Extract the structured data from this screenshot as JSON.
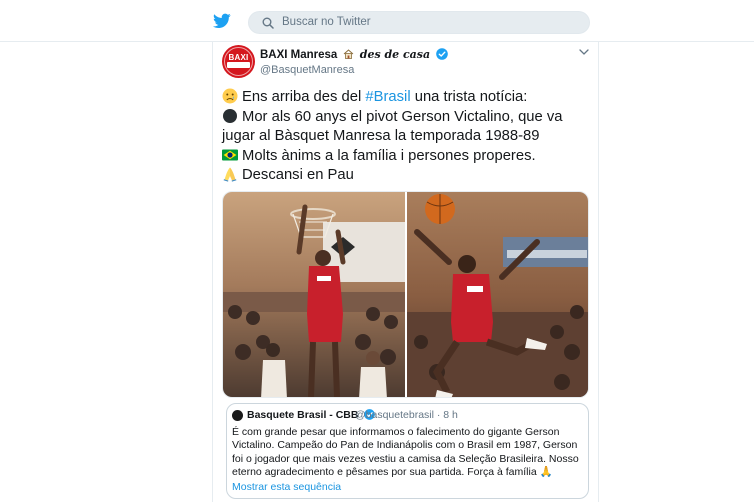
{
  "header": {
    "search_placeholder": "Buscar no Twitter"
  },
  "tweet": {
    "avatar_text": "BAXI",
    "display_name": "BAXI Manresa",
    "name_suffix": "des de casa",
    "handle": "@BasquetManresa",
    "lines": [
      "Ens arriba des del ",
      "#Brasil",
      " una trista notícia:",
      "Mor als 60 anys el pivot Gerson Victalino, que va",
      "jugar al Bàsquet Manresa la temporada 1988-89",
      "Molts ànims a la família i persones properes.",
      "Descansi en Pau"
    ]
  },
  "quoted": {
    "display_name": "Basquete Brasil - CBB",
    "handle_time": "@basquetebrasil · 8 h",
    "text": "É com grande pesar que informamos o falecimento do gigante Gerson Victalino. Campeão do Pan de Indianápolis com o Brasil em 1987, Gerson foi o jogador que mais vezes vestiu a camisa da Seleção Brasileira. Nosso eterno agradecimento e pêsames por sua partida. Força à família 🙏",
    "show_thread": "Mostrar esta sequência"
  },
  "colors": {
    "twitter_blue": "#1da1f2",
    "link_blue": "#1b95e0",
    "jersey_red": "#c8202c"
  },
  "icons": [
    "twitter-bird-icon",
    "search-icon",
    "house-icon",
    "verified-badge-icon",
    "chevron-down-icon",
    "sad-face-emoji",
    "black-circle-emoji",
    "brazil-flag-emoji",
    "folded-hands-emoji"
  ]
}
